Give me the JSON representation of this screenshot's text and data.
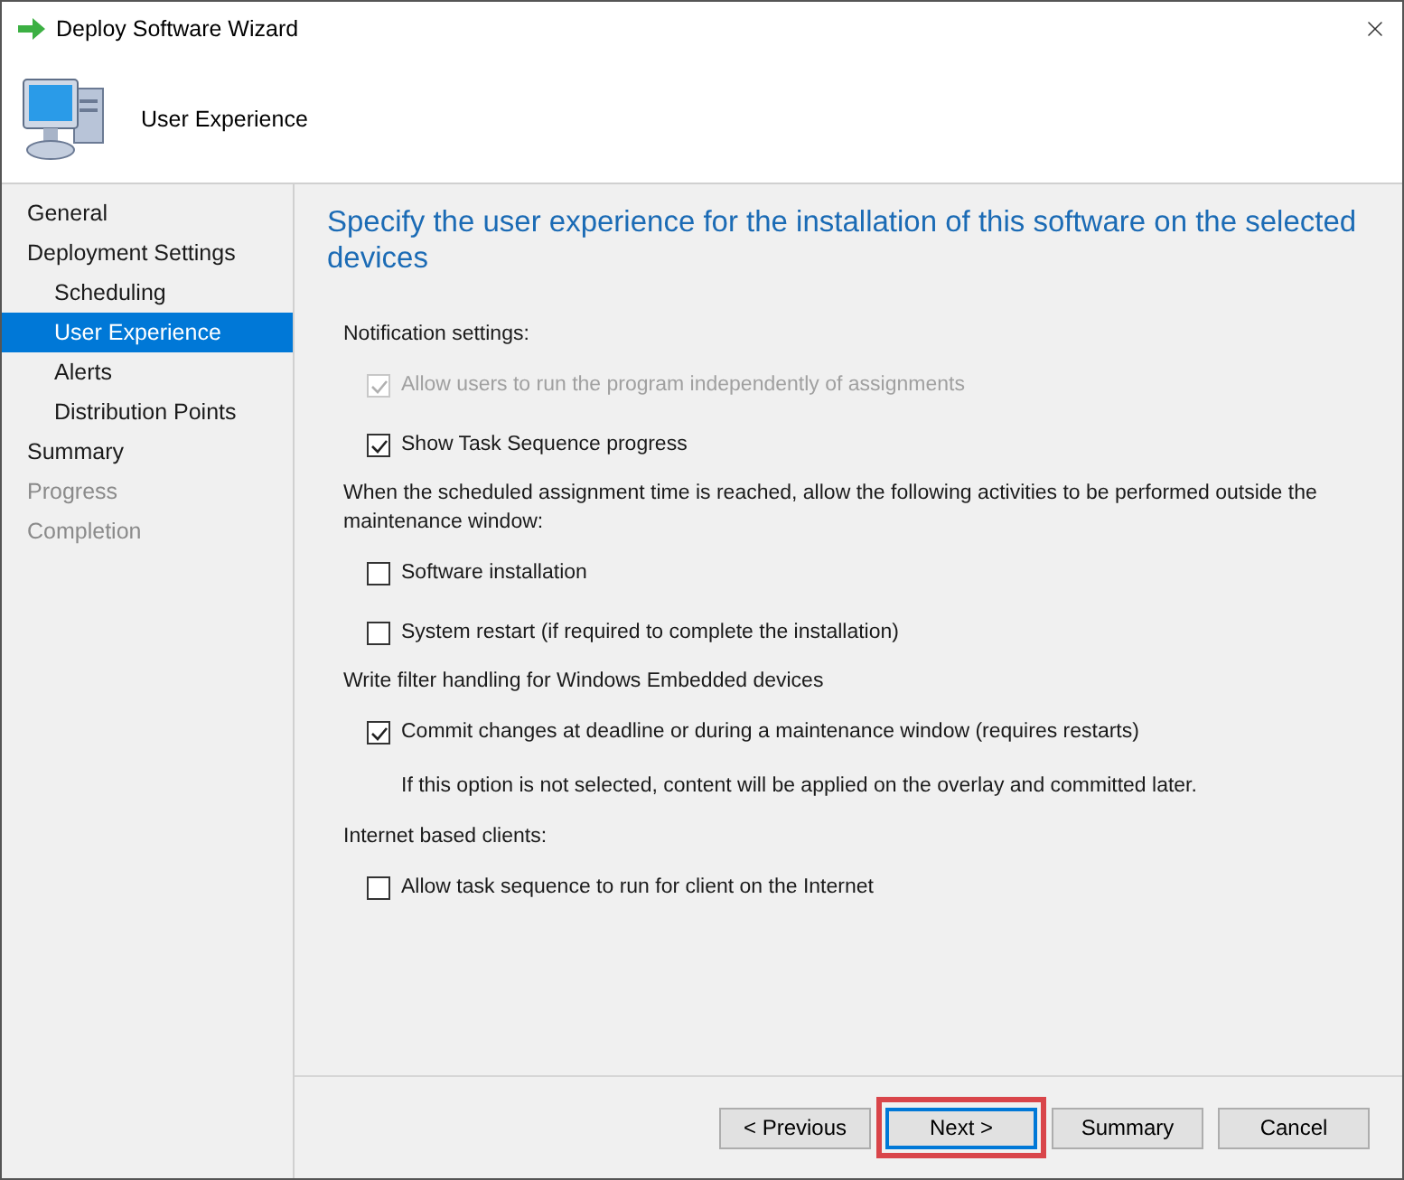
{
  "window": {
    "title": "Deploy Software Wizard"
  },
  "header": {
    "title": "User Experience"
  },
  "sidebar": {
    "items": [
      {
        "label": "General",
        "selected": false,
        "disabled": false
      },
      {
        "label": "Deployment Settings",
        "selected": false,
        "disabled": false,
        "children": [
          {
            "label": "Scheduling",
            "selected": false,
            "disabled": false
          },
          {
            "label": "User Experience",
            "selected": true,
            "disabled": false
          },
          {
            "label": "Alerts",
            "selected": false,
            "disabled": false
          },
          {
            "label": "Distribution Points",
            "selected": false,
            "disabled": false
          }
        ]
      },
      {
        "label": "Summary",
        "selected": false,
        "disabled": false
      },
      {
        "label": "Progress",
        "selected": false,
        "disabled": true
      },
      {
        "label": "Completion",
        "selected": false,
        "disabled": true
      }
    ]
  },
  "page": {
    "heading": "Specify the user experience for the installation of this software on the selected devices",
    "sections": [
      {
        "label": "Notification settings:",
        "items": [
          {
            "kind": "checkbox",
            "label": "Allow users to run the program independently of assignments",
            "checked": true,
            "disabled": true
          },
          {
            "kind": "checkbox",
            "label": "Show Task Sequence progress",
            "checked": true,
            "disabled": false
          }
        ]
      },
      {
        "label": "When the scheduled assignment time is reached, allow the following activities to be performed outside the maintenance window:",
        "items": [
          {
            "kind": "checkbox",
            "label": "Software installation",
            "checked": false,
            "disabled": false
          },
          {
            "kind": "checkbox",
            "label": "System restart (if required to complete the installation)",
            "checked": false,
            "disabled": false
          }
        ]
      },
      {
        "label": "Write filter handling for Windows Embedded devices",
        "items": [
          {
            "kind": "checkbox",
            "label": "Commit changes at deadline or during a maintenance window (requires restarts)",
            "checked": true,
            "disabled": false
          },
          {
            "kind": "note",
            "label": "If this option is not selected, content will be applied on the overlay and committed later."
          }
        ]
      },
      {
        "label": "Internet based clients:",
        "items": [
          {
            "kind": "checkbox",
            "label": "Allow task sequence to run for client on the Internet",
            "checked": false,
            "disabled": false
          }
        ]
      }
    ]
  },
  "buttons": [
    {
      "label": "< Previous",
      "default": false,
      "highlighted": false
    },
    {
      "label": "Next >",
      "default": true,
      "highlighted": true
    },
    {
      "label": "Summary",
      "default": false,
      "highlighted": false
    },
    {
      "label": "Cancel",
      "default": false,
      "highlighted": false
    }
  ]
}
